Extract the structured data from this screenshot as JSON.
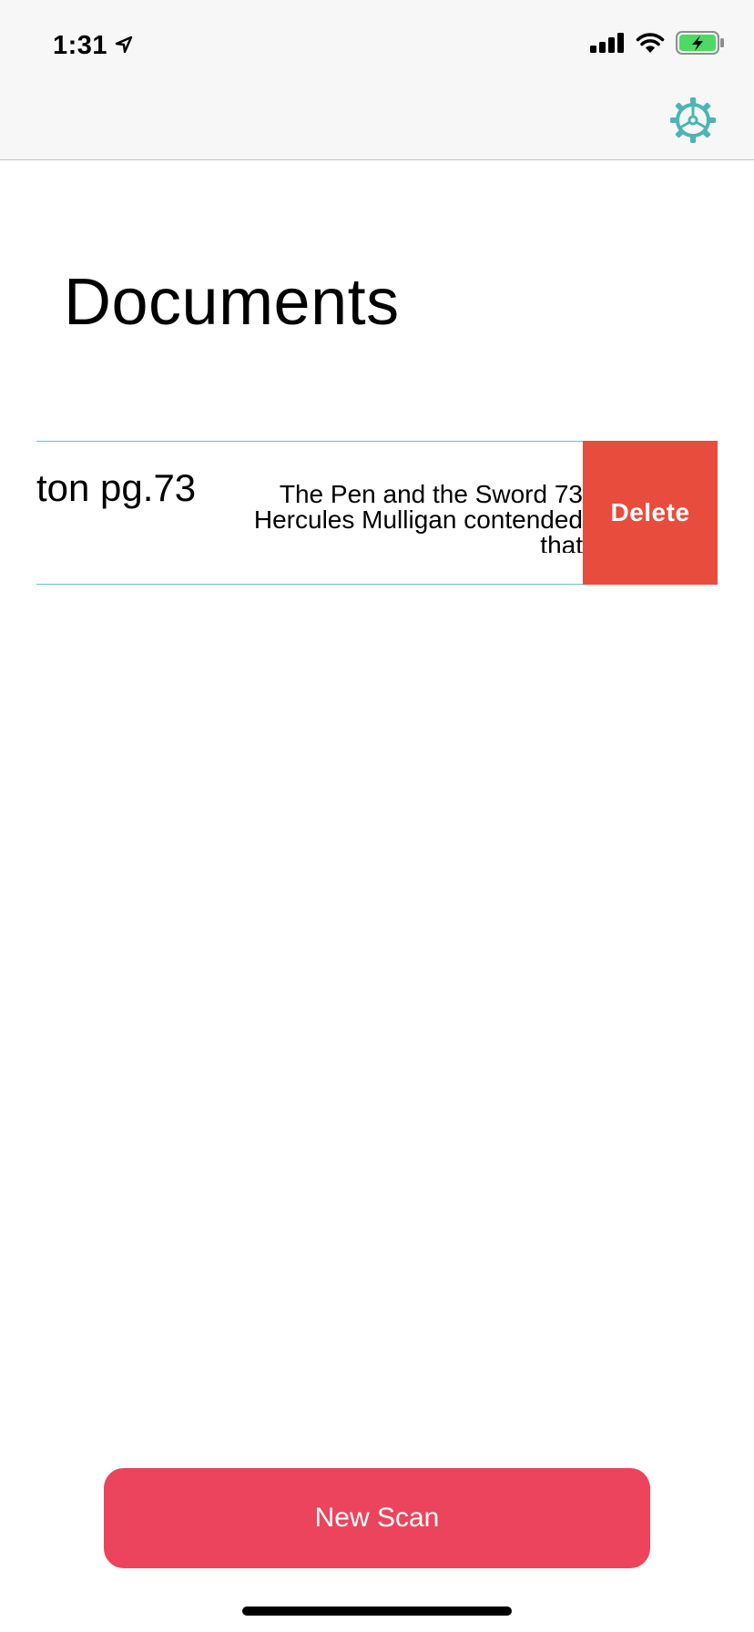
{
  "status_bar": {
    "time": "1:31",
    "icons": [
      "location-arrow-icon",
      "cellular-signal-icon",
      "wifi-icon",
      "battery-charging-icon"
    ],
    "battery_color": "#4cd964"
  },
  "nav": {
    "settings_icon": "gear-icon",
    "accent_color": "#4bb5b5"
  },
  "page": {
    "title": "Documents"
  },
  "documents": [
    {
      "title": "ton pg.73",
      "snippet": "The Pen and the Sword 73 Hercules Mulligan contended that",
      "delete_label": "Delete",
      "delete_color": "#e84c3d"
    }
  ],
  "footer": {
    "new_scan_label": "New Scan",
    "button_color": "#ec445d"
  }
}
